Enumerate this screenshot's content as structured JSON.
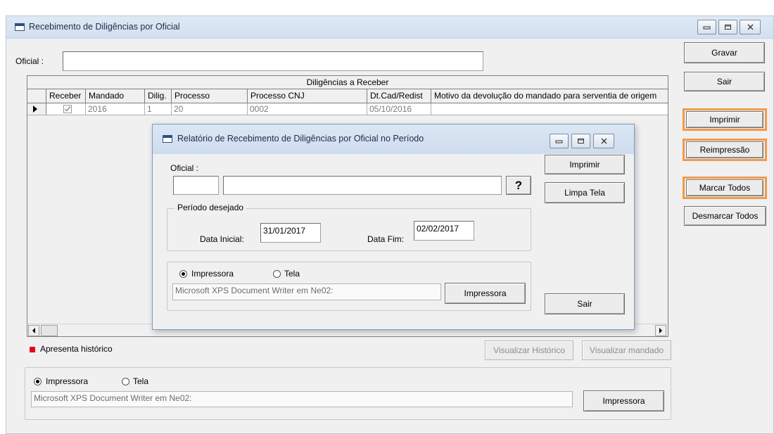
{
  "main": {
    "title": "Recebimento de Diligências por Oficial",
    "oficial_label": "Oficial :",
    "oficial_value": "",
    "buttons": {
      "gravar": "Gravar",
      "sair": "Sair",
      "imprimir": "Imprimir",
      "reimpressao": "Reimpressão",
      "marcar_todos": "Marcar Todos",
      "desmarcar_todos": "Desmarcar Todos",
      "visualizar_historico": "Visualizar Histórico",
      "visualizar_mandado": "Visualizar mandado",
      "impressora": "Impressora"
    },
    "grid": {
      "caption": "Diligências a Receber",
      "columns": [
        "Receber",
        "Mandado",
        "Dilig.",
        "Processo",
        "Processo CNJ",
        "Dt.Cad/Redist",
        "Motivo da devolução do mandado para serventia de origem"
      ],
      "rows": [
        {
          "receber": "checked",
          "mandado": "2016",
          "dilig": "1",
          "processo": "20",
          "processo_cnj": "0002",
          "dt_cad": "05/10/2016",
          "motivo": ""
        }
      ]
    },
    "legend_text": "Apresenta histórico",
    "legend_color": "#e8001c",
    "output": {
      "option_printer": "Impressora",
      "option_screen": "Tela",
      "selected": "Impressora",
      "printer_name": "Microsoft XPS Document Writer em Ne02:"
    }
  },
  "dialog": {
    "title": "Relatório de Recebimento de Diligências por Oficial no Período",
    "oficial_label": "Oficial :",
    "oficial_code": "",
    "oficial_name": "",
    "lookup_button": "?",
    "periodo_label": "Período desejado",
    "data_inicial_label": "Data Inicial:",
    "data_inicial": "31/01/2017",
    "data_fim_label": "Data Fim:",
    "data_fim": "02/02/2017",
    "option_printer": "Impressora",
    "option_screen": "Tela",
    "selected": "Impressora",
    "printer_name": "Microsoft XPS Document Writer em Ne02:",
    "buttons": {
      "imprimir": "Imprimir",
      "limpa_tela": "Limpa Tela",
      "impressora": "Impressora",
      "sair": "Sair"
    }
  },
  "colors": {
    "highlight": "#f29a4a",
    "titlebar": "#d3e0ef"
  }
}
